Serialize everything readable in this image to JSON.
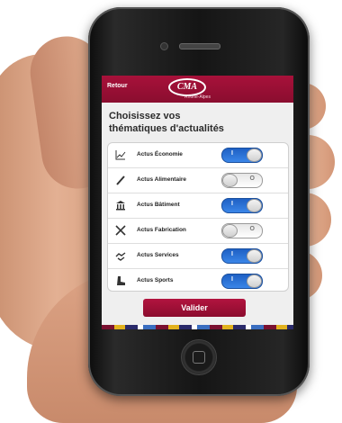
{
  "header": {
    "back_label": "Retour",
    "logo_text": "CMA",
    "region": "Rhône-Alpes"
  },
  "page": {
    "title_line1": "Choisissez vos",
    "title_line2": "thématiques d'actualités"
  },
  "topics": [
    {
      "label": "Actus Économie",
      "icon": "chart-icon",
      "on": true
    },
    {
      "label": "Actus Alimentaire",
      "icon": "knife-icon",
      "on": false
    },
    {
      "label": "Actus Bâtiment",
      "icon": "building-icon",
      "on": true
    },
    {
      "label": "Actus Fabrication",
      "icon": "tools-icon",
      "on": false
    },
    {
      "label": "Actus Services",
      "icon": "services-icon",
      "on": true
    },
    {
      "label": "Actus Sports",
      "icon": "boot-icon",
      "on": true
    }
  ],
  "toggle_marks": {
    "on": "I",
    "off": "O"
  },
  "validate_label": "Valider",
  "colors": {
    "brand": "#9a0f35",
    "toggle_on": "#2a72d6"
  }
}
